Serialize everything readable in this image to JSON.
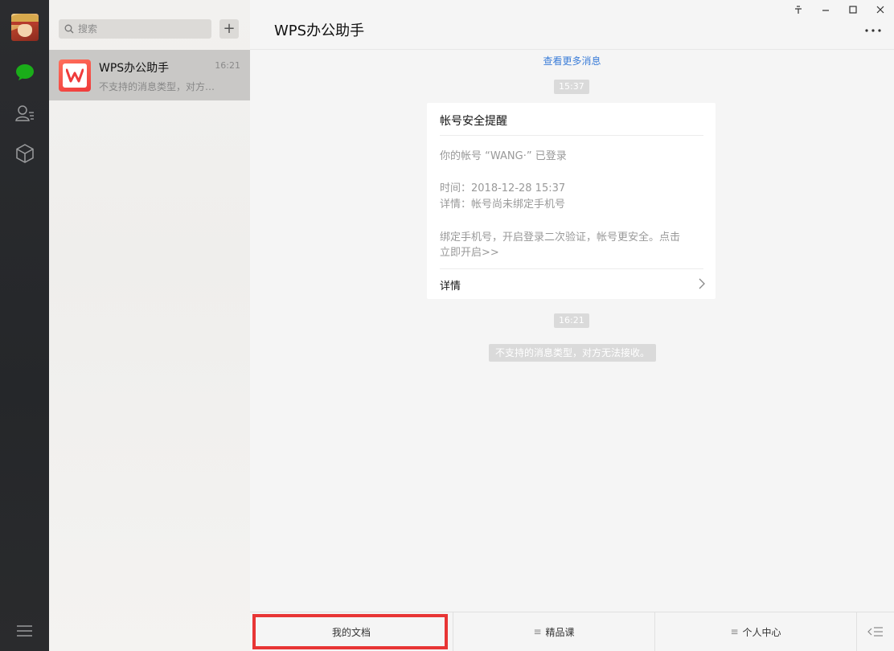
{
  "search": {
    "placeholder": "搜索"
  },
  "chat_list": [
    {
      "name": "WPS办公助手",
      "time": "16:21",
      "preview": "不支持的消息类型，对方无法接收。"
    }
  ],
  "chat": {
    "title": "WPS办公助手",
    "load_more": "查看更多消息",
    "time_1": "15:37",
    "card": {
      "title": "帐号安全提醒",
      "line_account": "你的帐号 “WANG·” 已登录",
      "line_time": "时间：2018-12-28 15:37",
      "line_detail": "详情：帐号尚未绑定手机号",
      "line_bind_1": "绑定手机号，开启登录二次验证，帐号更安全。点击",
      "line_bind_2": "立即开启>>",
      "detail_link": "详情"
    },
    "time_2": "16:21",
    "system_message": "不支持的消息类型，对方无法接收。"
  },
  "bottom_menu": {
    "item_1": "我的文档",
    "item_2": "精品课",
    "item_3": "个人中心"
  },
  "icons": {
    "chat": "chat-bubble-icon",
    "contacts": "contacts-icon",
    "collection": "cube-icon",
    "menu": "hamburger-icon",
    "search": "search-icon",
    "add": "plus-icon",
    "more": "more-dots-icon",
    "keyboard": "keyboard-toggle-icon"
  },
  "colors": {
    "accent_green": "#1aad19",
    "link_blue": "#3b7dd8",
    "highlight_red": "#e83535"
  }
}
